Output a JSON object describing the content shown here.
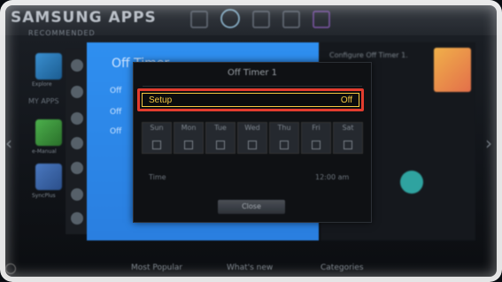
{
  "header": {
    "app_title": "SAMSUNG APPS",
    "recommended": "RECOMMENDED"
  },
  "left": {
    "my_apps": "MY APPS",
    "labels": [
      "Explore",
      "e-Manual",
      "SyncPlus"
    ]
  },
  "blue_panel": {
    "title": "Off Timer",
    "items": [
      "Off",
      "Off",
      "Off"
    ]
  },
  "right_panel": {
    "title": "Configure Off Timer 1."
  },
  "dialog": {
    "title": "Off Timer 1",
    "setup_label": "Setup",
    "setup_value": "Off",
    "days": [
      "Sun",
      "Mon",
      "Tue",
      "Wed",
      "Thu",
      "Fri",
      "Sat"
    ],
    "time_label": "Time",
    "time_value": "12:00 am",
    "close_label": "Close"
  },
  "bottom_nav": {
    "items": [
      "Most Popular",
      "What's new",
      "Categories"
    ]
  },
  "colors": {
    "highlight_border": "#e23c2e",
    "focus_text": "#f3c640",
    "panel_blue": "#2f8ff0"
  }
}
